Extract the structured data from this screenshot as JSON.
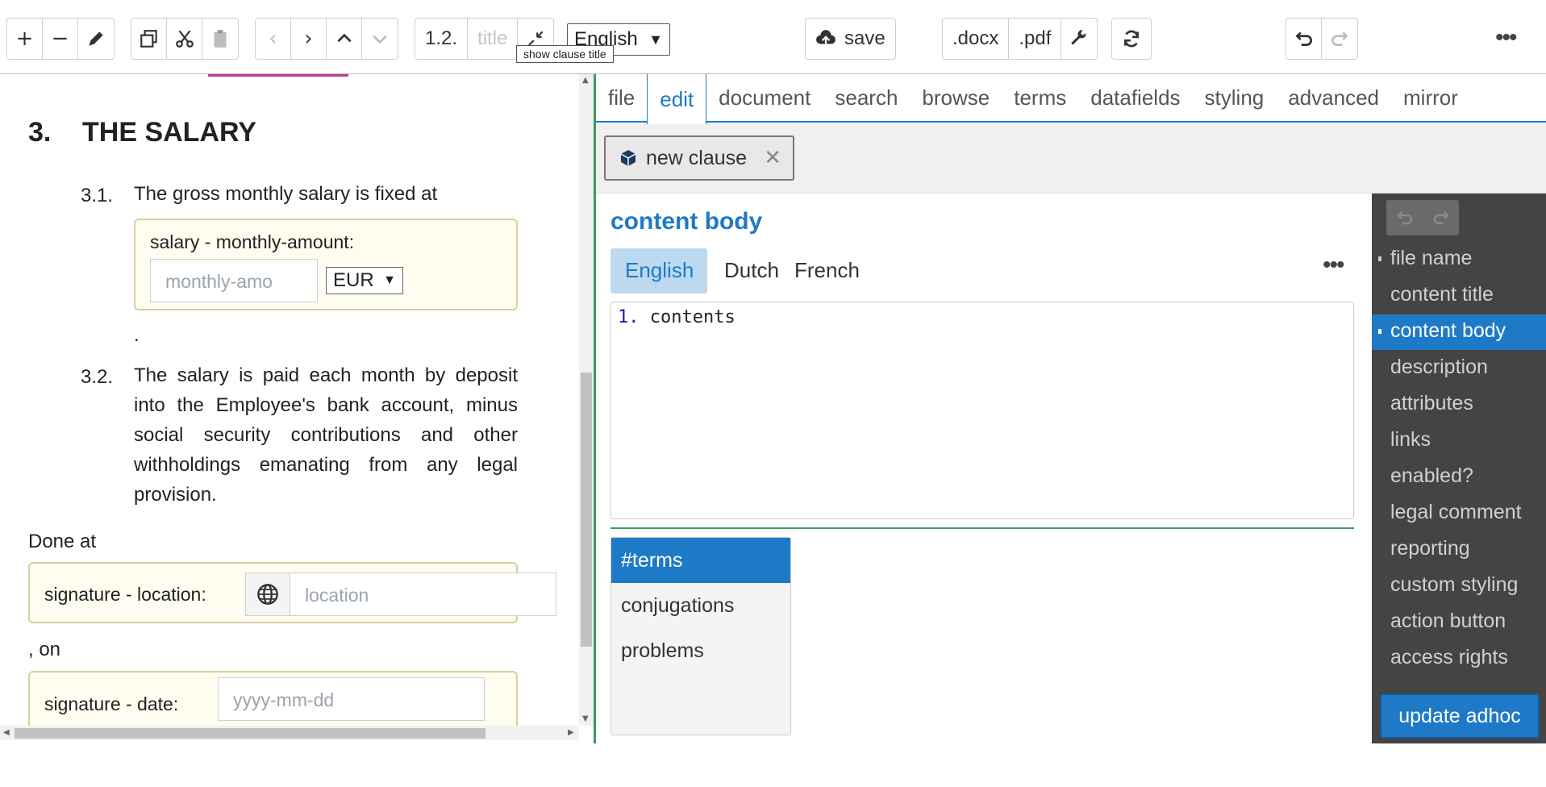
{
  "toolbar": {
    "clause_number": "1.2.",
    "title_placeholder": "title",
    "language": "English",
    "tooltip": "show clause title",
    "save_label": "save",
    "docx_label": ".docx",
    "pdf_label": ".pdf"
  },
  "document": {
    "section_number": "3.",
    "section_title": "THE SALARY",
    "clause_1_number": "3.1.",
    "clause_1_text": "The gross monthly salary is fixed at",
    "salary_label": "salary - monthly-amount:",
    "salary_placeholder": "monthly-amo",
    "currency": "EUR",
    "period": ".",
    "clause_2_number": "3.2.",
    "clause_2_text": "The salary is paid each month by deposit into the Employee's bank account, minus social security contributions and other withholdings emanating from any legal provision.",
    "done_at": "Done at",
    "location_label": "signature - location:",
    "location_placeholder": "location",
    "on_text": ", on",
    "date_label": "signature - date:",
    "date_placeholder": "yyyy-mm-dd"
  },
  "tabs": [
    "file",
    "edit",
    "document",
    "search",
    "browse",
    "terms",
    "datafields",
    "styling",
    "advanced",
    "mirror"
  ],
  "active_tab": "edit",
  "new_clause_label": "new clause",
  "editor": {
    "heading": "content body",
    "languages": [
      "English",
      "Dutch",
      "French"
    ],
    "active_language": "English",
    "code_line_number": "1.",
    "code_text": "contents"
  },
  "bottom_list": [
    "#terms",
    "conjugations",
    "problems"
  ],
  "side_nav": {
    "items": [
      "file name",
      "content title",
      "content body",
      "description",
      "attributes",
      "links",
      "enabled?",
      "legal comment",
      "reporting",
      "custom styling",
      "action button",
      "access rights"
    ],
    "active": "content body",
    "update_label": "update adhoc"
  },
  "colors": {
    "accent": "#1e7ac6",
    "sidebar_bg": "#444444",
    "datafield_bg": "#fffdf0",
    "separator_green": "#3a9a5b"
  }
}
